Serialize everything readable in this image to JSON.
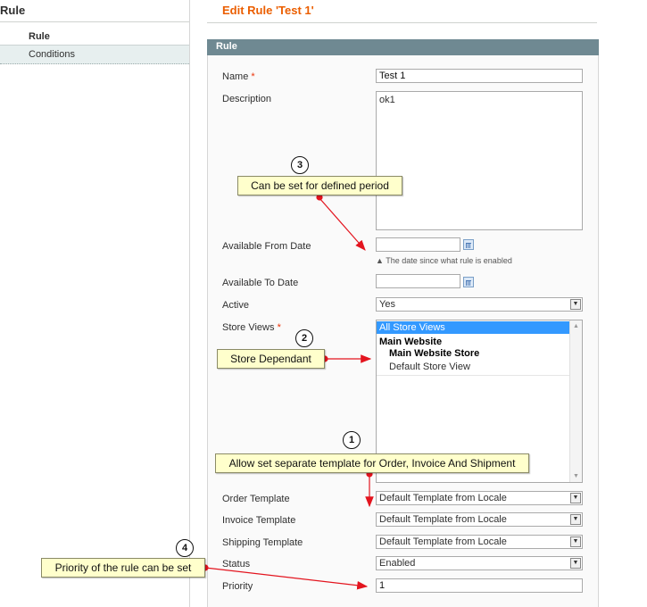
{
  "sidebar": {
    "title": "Rule",
    "tabs": [
      {
        "label": "Rule"
      },
      {
        "label": "Conditions"
      }
    ]
  },
  "page_title": "Edit Rule 'Test 1'",
  "fieldset_title": "Rule",
  "form": {
    "name": {
      "label": "Name",
      "required": "*",
      "value": "Test 1"
    },
    "description": {
      "label": "Description",
      "value": "ok1"
    },
    "from_date": {
      "label": "Available From Date",
      "value": "",
      "hint": "▲ The date since what rule is enabled"
    },
    "to_date": {
      "label": "Available To Date",
      "value": ""
    },
    "active": {
      "label": "Active",
      "value": "Yes"
    },
    "store_views": {
      "label": "Store Views",
      "required": "*",
      "options": [
        "All Store Views",
        "Main Website",
        "Main Website Store",
        "Default Store View"
      ]
    },
    "order_template": {
      "label": "Order Template",
      "value": "Default Template from Locale"
    },
    "invoice_template": {
      "label": "Invoice Template",
      "value": "Default Template from Locale"
    },
    "shipping_template": {
      "label": "Shipping Template",
      "value": "Default Template from Locale"
    },
    "status": {
      "label": "Status",
      "value": "Enabled"
    },
    "priority": {
      "label": "Priority",
      "value": "1"
    }
  },
  "callouts": [
    {
      "number": "1",
      "text": "Allow set separate template for Order, Invoice And Shipment"
    },
    {
      "number": "2",
      "text": "Store Dependant"
    },
    {
      "number": "3",
      "text": "Can be set for defined period"
    },
    {
      "number": "4",
      "text": "Priority of the rule can be set"
    }
  ],
  "colors": {
    "accent": "#eb5e00",
    "header": "#6f8992",
    "selected": "#3399ff",
    "callout": "#ffffcc",
    "arrow": "#e3141e"
  }
}
